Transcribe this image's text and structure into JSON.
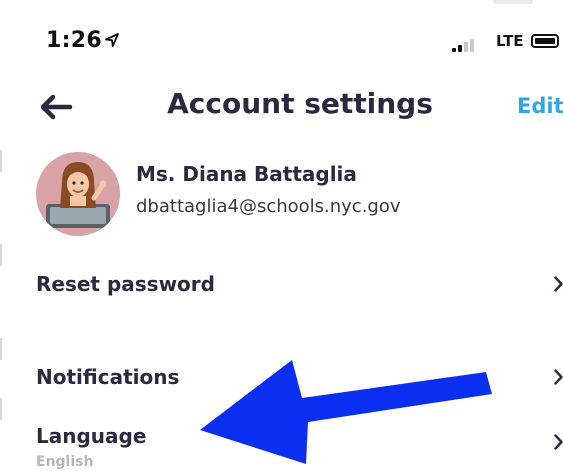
{
  "status_bar": {
    "time": "1:26",
    "carrier": "LTE"
  },
  "header": {
    "title": "Account settings",
    "edit_label": "Edit"
  },
  "profile": {
    "name": "Ms. Diana Battaglia",
    "email": "dbattaglia4@schools.nyc.gov"
  },
  "settings": {
    "items": [
      {
        "label": "Reset password"
      },
      {
        "label": "Notifications"
      },
      {
        "label": "Language",
        "value": "English"
      }
    ]
  },
  "colors": {
    "title": "#2b2840",
    "accent": "#2fa7e6",
    "annotation_arrow": "#0a2ff0",
    "muted": "#b7b5c4"
  },
  "icons": {
    "back": "arrow-left-icon",
    "location": "location-arrow-icon",
    "chevron": "chevron-right-icon",
    "battery": "battery-icon",
    "signal": "cell-signal-icon"
  }
}
